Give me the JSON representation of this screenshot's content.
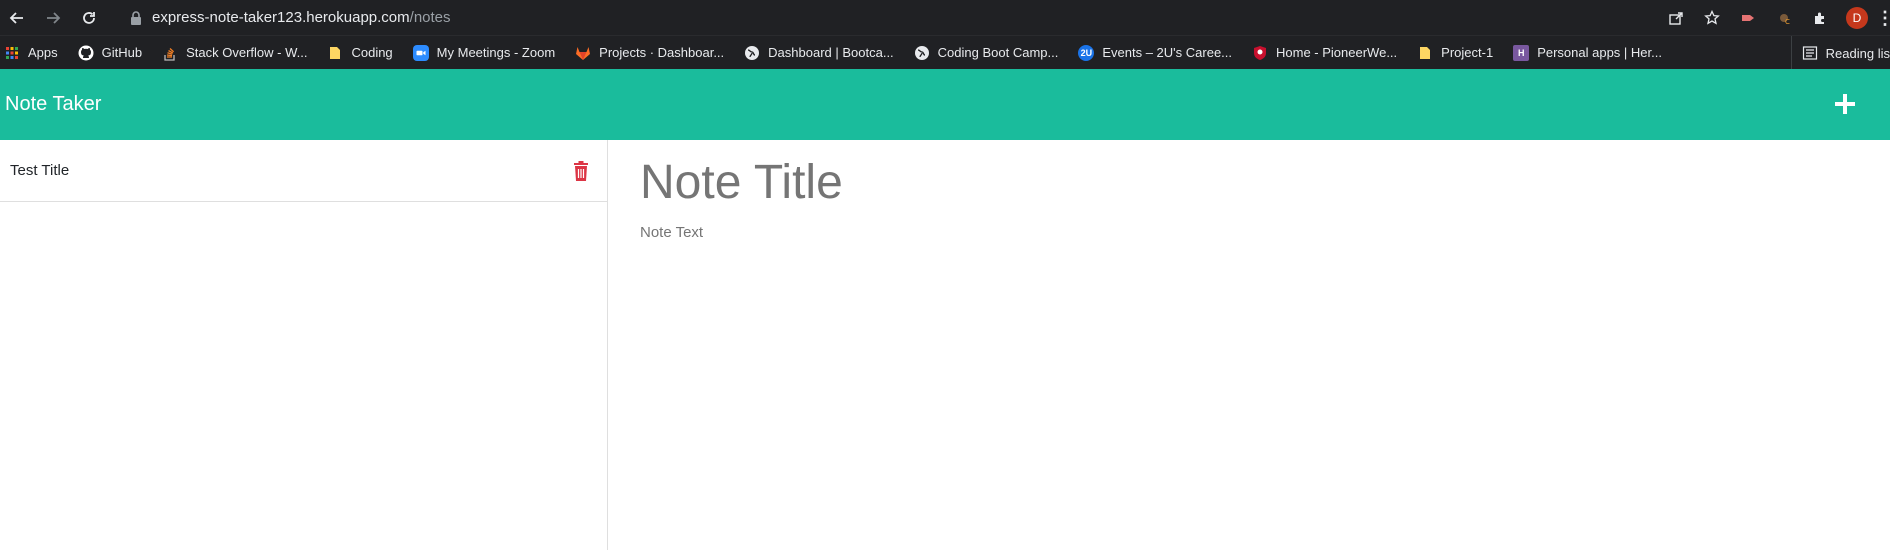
{
  "browser": {
    "url_host": "express-note-taker123.herokuapp.com",
    "url_path": "/notes",
    "profile_initial": "D",
    "bookmarks": [
      {
        "label": "Apps",
        "icon": "apps-grid-icon"
      },
      {
        "label": "GitHub",
        "icon": "github-icon"
      },
      {
        "label": "Stack Overflow - W...",
        "icon": "stackoverflow-icon"
      },
      {
        "label": "Coding",
        "icon": "folder-icon"
      },
      {
        "label": "My Meetings - Zoom",
        "icon": "zoom-icon"
      },
      {
        "label": "Projects · Dashboar...",
        "icon": "gitlab-icon"
      },
      {
        "label": "Dashboard | Bootca...",
        "icon": "globe-icon"
      },
      {
        "label": "Coding Boot Camp...",
        "icon": "globe-icon"
      },
      {
        "label": "Events – 2U's Caree...",
        "icon": "2u-icon"
      },
      {
        "label": "Home - PioneerWe...",
        "icon": "shield-logo-icon"
      },
      {
        "label": "Project-1",
        "icon": "folder-icon"
      },
      {
        "label": "Personal apps | Her...",
        "icon": "heroku-icon"
      }
    ],
    "reading_list_label": "Reading lis"
  },
  "app": {
    "brand": "Note Taker",
    "accent_color": "#1abc9c",
    "notes": [
      {
        "title": "Test Title"
      }
    ],
    "editor": {
      "title_placeholder": "Note Title",
      "text_placeholder": "Note Text"
    }
  }
}
